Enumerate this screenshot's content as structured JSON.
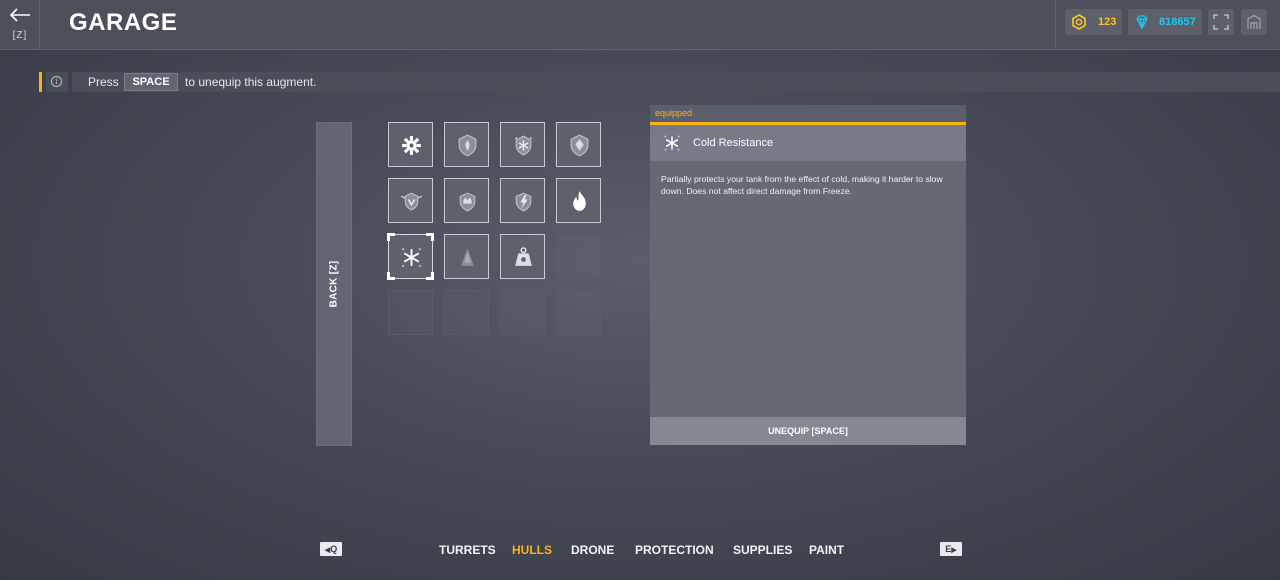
{
  "header": {
    "title": "GARAGE",
    "back_key": "[Z]",
    "crystals": "123",
    "tankoins": "818657",
    "colors": {
      "crystals": "#ffc61a",
      "tankoins": "#22c7ee"
    },
    "icons": [
      "back-arrow-icon",
      "crystal-coin-icon",
      "diamond-icon",
      "fullscreen-icon",
      "home-icon"
    ]
  },
  "hint": {
    "press": "Press",
    "key": "SPACE",
    "rest": "to unequip this augment."
  },
  "back_strip": {
    "label": "BACK [Z]"
  },
  "augments": {
    "rows": [
      [
        "gear",
        "shield-flame",
        "shield-frost",
        "shield-diamond"
      ],
      [
        "shield-wings",
        "shield-crown",
        "shield-lightning",
        "fire"
      ],
      [
        "snowflake",
        "cone",
        "weight",
        "empty"
      ],
      [
        "empty",
        "empty",
        "empty",
        "empty"
      ]
    ],
    "selected": "snowflake"
  },
  "details": {
    "tag": "equipped",
    "name": "Cold Resistance",
    "description": "Partially protects your tank from the effect of cold, making it harder to slow down. Does not affect direct damage from Freeze.",
    "button": "UNEQUIP [SPACE]",
    "accent": "#f7b31b"
  },
  "nav": {
    "prev_key": "Q",
    "next_key": "E",
    "items": [
      "TURRETS",
      "HULLS",
      "DRONE",
      "PROTECTION",
      "SUPPLIES",
      "PAINT"
    ],
    "active": "HULLS",
    "active_color": "#f7b31b"
  }
}
